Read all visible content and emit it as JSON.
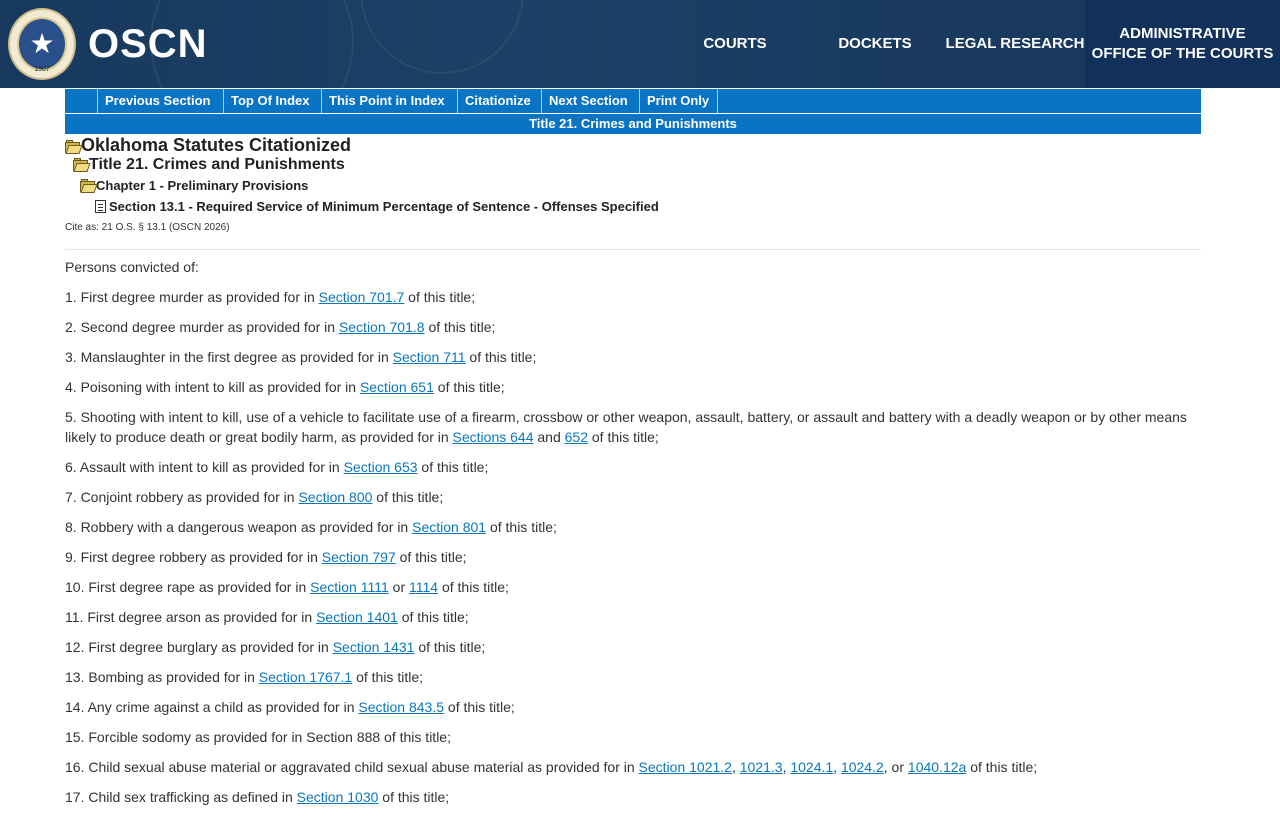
{
  "header": {
    "logo_text": "OSCN",
    "seal_year": "1907",
    "nav": [
      {
        "label": "COURTS"
      },
      {
        "label": "DOCKETS"
      },
      {
        "label": "LEGAL RESEARCH"
      },
      {
        "label": "ADMINISTRATIVE OFFICE OF THE COURTS"
      }
    ]
  },
  "toolbar": {
    "buttons": [
      {
        "label": "Previous Section"
      },
      {
        "label": "Top Of Index"
      },
      {
        "label": "This Point in Index"
      },
      {
        "label": "Citationize"
      },
      {
        "label": "Next Section"
      },
      {
        "label": "Print Only"
      }
    ],
    "title": "Title 21. Crimes and Punishments"
  },
  "tree": {
    "root": "Oklahoma Statutes Citationized",
    "title": "Title 21. Crimes and Punishments",
    "chapter": "Chapter 1 - Preliminary Provisions",
    "section": "Section 13.1 - Required Service of Minimum Percentage of Sentence - Offenses Specified"
  },
  "cite": "Cite as: 21 O.S. § 13.1 (OSCN 2026)",
  "content": {
    "intro": "Persons convicted of:",
    "items": [
      {
        "parts": [
          "1. First degree murder as provided for in ",
          {
            "link": "Section 701.7"
          },
          " of this title;"
        ]
      },
      {
        "parts": [
          "2. Second degree murder as provided for in ",
          {
            "link": "Section 701.8"
          },
          " of this title;"
        ]
      },
      {
        "parts": [
          "3. Manslaughter in the first degree as provided for in ",
          {
            "link": "Section 711"
          },
          " of this title;"
        ]
      },
      {
        "parts": [
          "4. Poisoning with intent to kill as provided for in ",
          {
            "link": "Section 651"
          },
          " of this title;"
        ]
      },
      {
        "parts": [
          "5. Shooting with intent to kill, use of a vehicle to facilitate use of a firearm, crossbow or other weapon, assault, battery, or assault and battery with a deadly weapon or by other means likely to produce death or great bodily harm, as provided for in ",
          {
            "link": "Sections 644"
          },
          " and ",
          {
            "link": "652"
          },
          " of this title;"
        ]
      },
      {
        "parts": [
          "6. Assault with intent to kill as provided for in ",
          {
            "link": "Section 653"
          },
          " of this title;"
        ]
      },
      {
        "parts": [
          "7. Conjoint robbery as provided for in ",
          {
            "link": "Section 800"
          },
          " of this title;"
        ]
      },
      {
        "parts": [
          "8. Robbery with a dangerous weapon as provided for in ",
          {
            "link": "Section 801"
          },
          " of this title;"
        ]
      },
      {
        "parts": [
          "9. First degree robbery as provided for in ",
          {
            "link": "Section 797"
          },
          " of this title;"
        ]
      },
      {
        "parts": [
          "10. First degree rape as provided for in ",
          {
            "link": "Section 1111"
          },
          " or ",
          {
            "link": "1114"
          },
          " of this title;"
        ]
      },
      {
        "parts": [
          "11. First degree arson as provided for in ",
          {
            "link": "Section 1401"
          },
          " of this title;"
        ]
      },
      {
        "parts": [
          "12. First degree burglary as provided for in ",
          {
            "link": "Section 1431"
          },
          " of this title;"
        ]
      },
      {
        "parts": [
          "13. Bombing as provided for in ",
          {
            "link": "Section 1767.1"
          },
          " of this title;"
        ]
      },
      {
        "parts": [
          "14. Any crime against a child as provided for in ",
          {
            "link": "Section 843.5"
          },
          " of this title;"
        ]
      },
      {
        "parts": [
          "15. Forcible sodomy as provided for in Section 888 of this title;"
        ]
      },
      {
        "parts": [
          "16. Child sexual abuse material or aggravated child sexual abuse material as provided for in ",
          {
            "link": "Section 1021.2"
          },
          ", ",
          {
            "link": "1021.3"
          },
          ", ",
          {
            "link": "1024.1"
          },
          ", ",
          {
            "link": "1024.2"
          },
          ", or ",
          {
            "link": "1040.12a"
          },
          " of this title;"
        ]
      },
      {
        "parts": [
          "17. Child sex trafficking as defined in ",
          {
            "link": "Section 1030"
          },
          " of this title;"
        ]
      }
    ]
  },
  "colors": {
    "header_bg": "#1b3a5c",
    "toolbar_bg": "#0a74c4",
    "link": "#0b76b8"
  }
}
